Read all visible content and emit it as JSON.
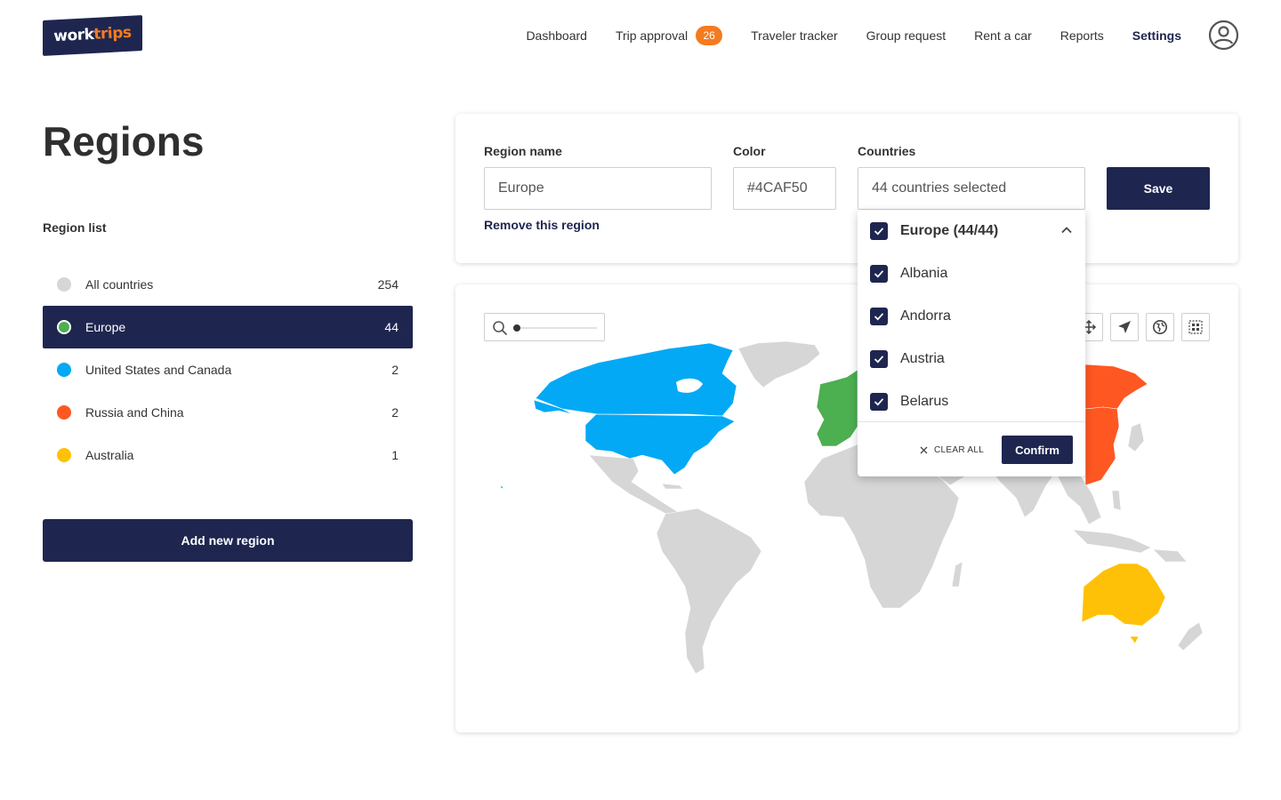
{
  "brand": {
    "logo_work": "work",
    "logo_trips": "trips",
    "logo_accent": "#F47B20",
    "logo_bg": "#1E2650"
  },
  "nav": {
    "items": [
      {
        "label": "Dashboard"
      },
      {
        "label": "Trip approval",
        "badge": "26"
      },
      {
        "label": "Traveler tracker"
      },
      {
        "label": "Group request"
      },
      {
        "label": "Rent a car"
      },
      {
        "label": "Reports"
      },
      {
        "label": "Settings",
        "active": true
      }
    ],
    "avatar_icon": "user-circle-icon"
  },
  "page": {
    "title": "Regions",
    "region_list_label": "Region list"
  },
  "regions": [
    {
      "name": "All countries",
      "count": "254",
      "color": "#D6D6D6",
      "selected": false
    },
    {
      "name": "Europe",
      "count": "44",
      "color": "#4CAF50",
      "selected": true
    },
    {
      "name": "United States and Canada",
      "count": "2",
      "color": "#03A9F4",
      "selected": false
    },
    {
      "name": "Russia and China",
      "count": "2",
      "color": "#FF5722",
      "selected": false
    },
    {
      "name": "Australia",
      "count": "1",
      "color": "#FFC107",
      "selected": false
    }
  ],
  "add_region_label": "Add new region",
  "form": {
    "region_name_label": "Region name",
    "region_name_value": "Europe",
    "color_label": "Color",
    "color_value": "#4CAF50",
    "countries_label": "Countries",
    "countries_value": "44 countries selected",
    "remove_label": "Remove this region",
    "save_label": "Save"
  },
  "dropdown": {
    "group_label": "Europe (44/44)",
    "items": [
      {
        "label": "Albania",
        "checked": true
      },
      {
        "label": "Andorra",
        "checked": true
      },
      {
        "label": "Austria",
        "checked": true
      },
      {
        "label": "Belarus",
        "checked": true
      }
    ],
    "clear_all_label": "CLEAR ALL",
    "confirm_label": "Confirm"
  },
  "map": {
    "tools": [
      "move-icon",
      "locate-arrow-icon",
      "globe-icon",
      "grid-select-icon"
    ],
    "default_country_color": "#D6D6D6"
  }
}
